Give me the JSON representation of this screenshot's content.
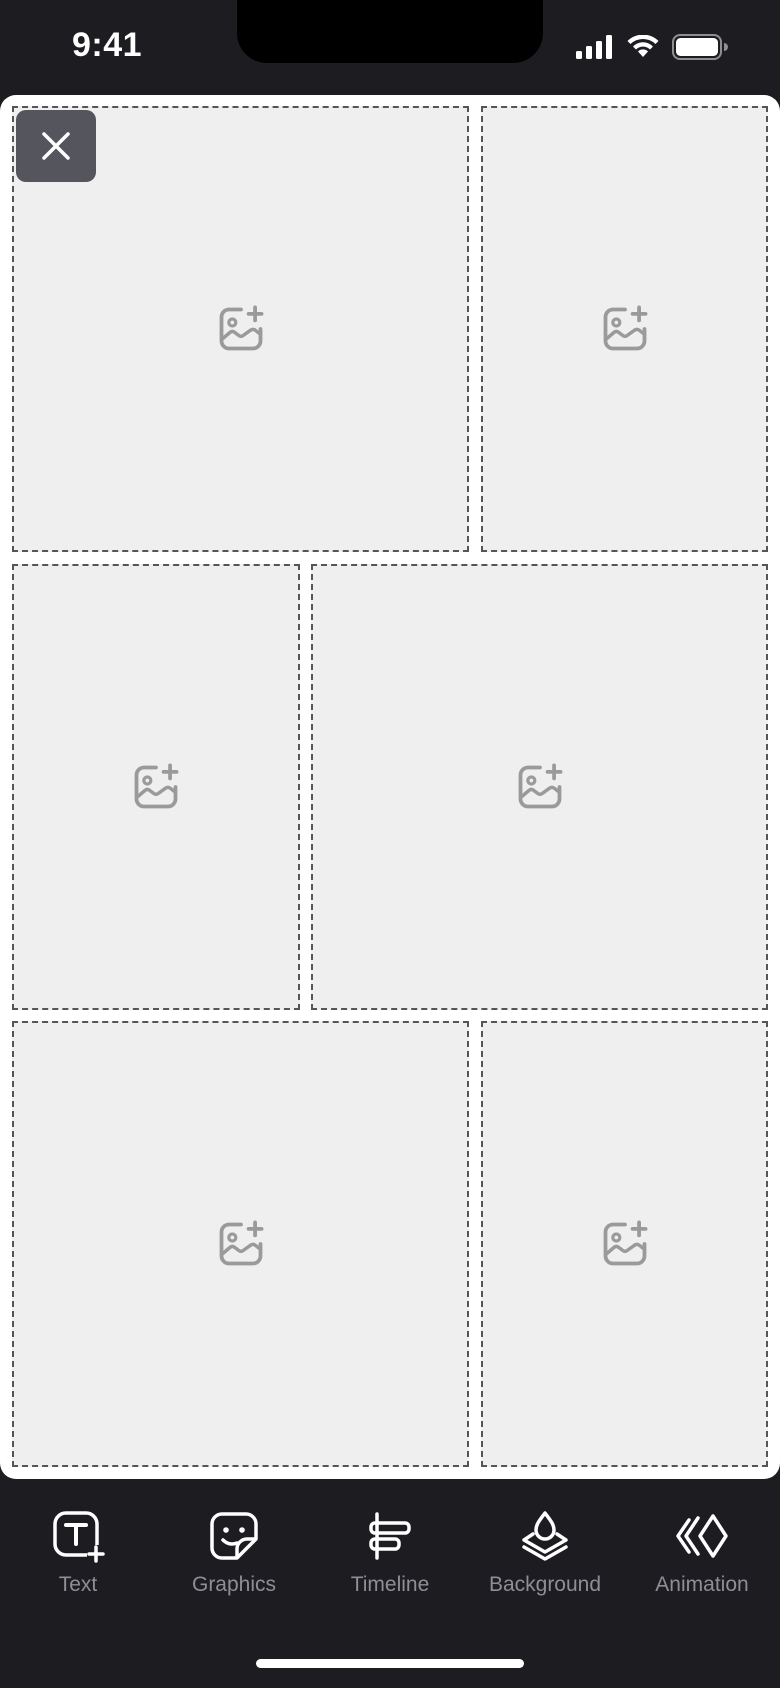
{
  "status_bar": {
    "time": "9:41"
  },
  "canvas": {
    "close_icon": "close-icon",
    "cells": [
      {
        "icon": "add-photo-icon"
      },
      {
        "icon": "add-photo-icon"
      },
      {
        "icon": "add-photo-icon"
      },
      {
        "icon": "add-photo-icon"
      },
      {
        "icon": "add-photo-icon"
      },
      {
        "icon": "add-photo-icon"
      }
    ]
  },
  "toolbar": {
    "items": [
      {
        "label": "Text",
        "icon": "text-add-icon"
      },
      {
        "label": "Graphics",
        "icon": "sticker-icon"
      },
      {
        "label": "Timeline",
        "icon": "timeline-icon"
      },
      {
        "label": "Background",
        "icon": "background-layers-icon"
      },
      {
        "label": "Animation",
        "icon": "animation-icon"
      }
    ]
  },
  "colors": {
    "background": "#1c1c21",
    "canvas": "#ffffff",
    "cell_fill": "#efefef",
    "cell_border": "#555555",
    "label": "#8e8e96"
  }
}
